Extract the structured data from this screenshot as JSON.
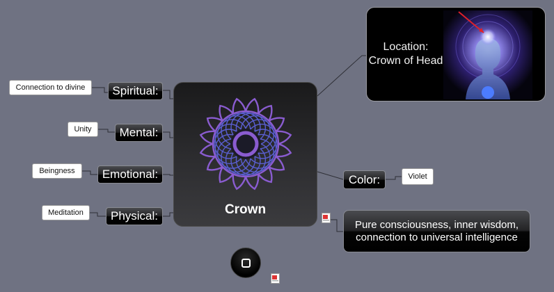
{
  "center": {
    "title": "Crown",
    "symbol": "crown-chakra-icon",
    "color": "#8a5cd0"
  },
  "branches_left": [
    {
      "label": "Spiritual:",
      "value": "Connection to divine"
    },
    {
      "label": "Mental:",
      "value": "Unity"
    },
    {
      "label": "Emotional:",
      "value": "Beingness"
    },
    {
      "label": "Physical:",
      "value": "Meditation"
    }
  ],
  "location": {
    "text": "Location: Crown of Head",
    "image": "meditating-head-aura-image"
  },
  "color": {
    "label": "Color:",
    "value": "Violet"
  },
  "description": "Pure consciousness, inner wisdom, connection to universal intelligence",
  "colors": {
    "background": "#6f7282",
    "violet": "#8a5cd0",
    "indigo": "#4b4fb8"
  }
}
